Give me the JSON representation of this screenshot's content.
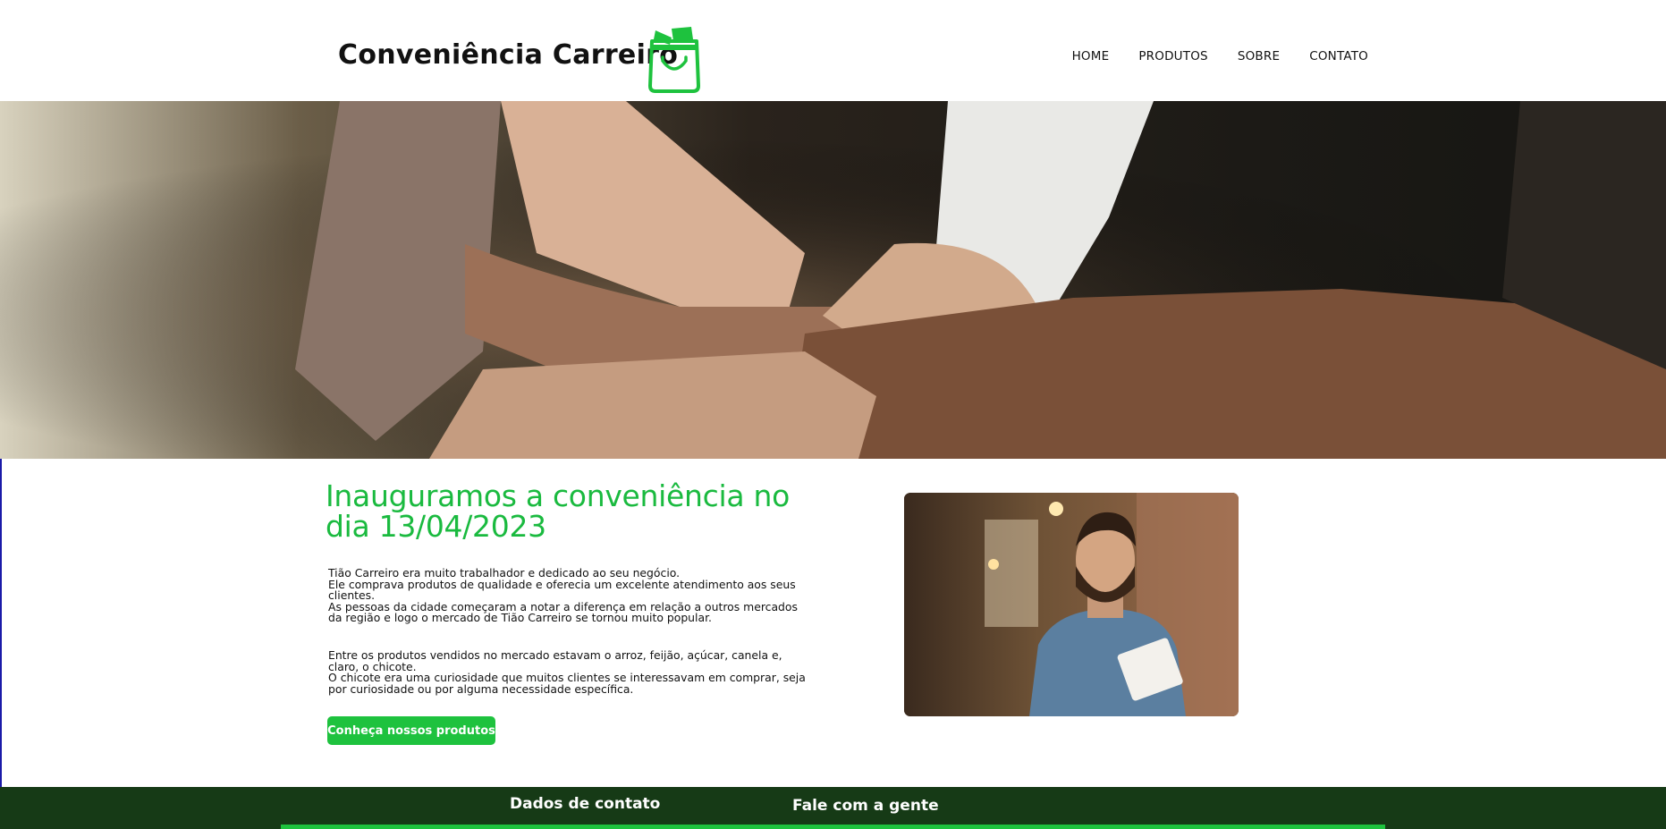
{
  "header": {
    "brand": "Conveniência Carreiro",
    "logo_icon": "shopping-bag-icon",
    "nav": [
      "HOME",
      "PRODUTOS",
      "SOBRE",
      "CONTATO"
    ]
  },
  "hero": {
    "image": "hands-stacked-teamwork-photo"
  },
  "main": {
    "headline": "Inauguramos a conveniência no dia 13/04/2023",
    "paragraph1": [
      "Tião Carreiro era muito trabalhador e dedicado ao seu negócio.",
      "Ele comprava produtos de qualidade e oferecia um excelente atendimento aos seus clientes.",
      "As pessoas da cidade começaram a notar a diferença em relação a outros mercados da região e logo o mercado de Tião Carreiro se tornou muito popular."
    ],
    "paragraph2": [
      "Entre os produtos vendidos no mercado estavam o arroz, feijão, açúcar, canela e, claro, o chicote.",
      "O chicote era uma curiosidade que muitos clientes se interessavam em comprar, seja por curiosidade ou por alguma necessidade específica."
    ],
    "cta_label": "Conheça nossos produtos",
    "photo": "smiling-man-with-notepad-photo"
  },
  "footer": {
    "contact_title": "Dados de contato",
    "talk_title": "Fale com a gente"
  },
  "colors": {
    "accent": "#1ec23e",
    "headline": "#1aba3f",
    "footer_bg": "#163a16"
  }
}
